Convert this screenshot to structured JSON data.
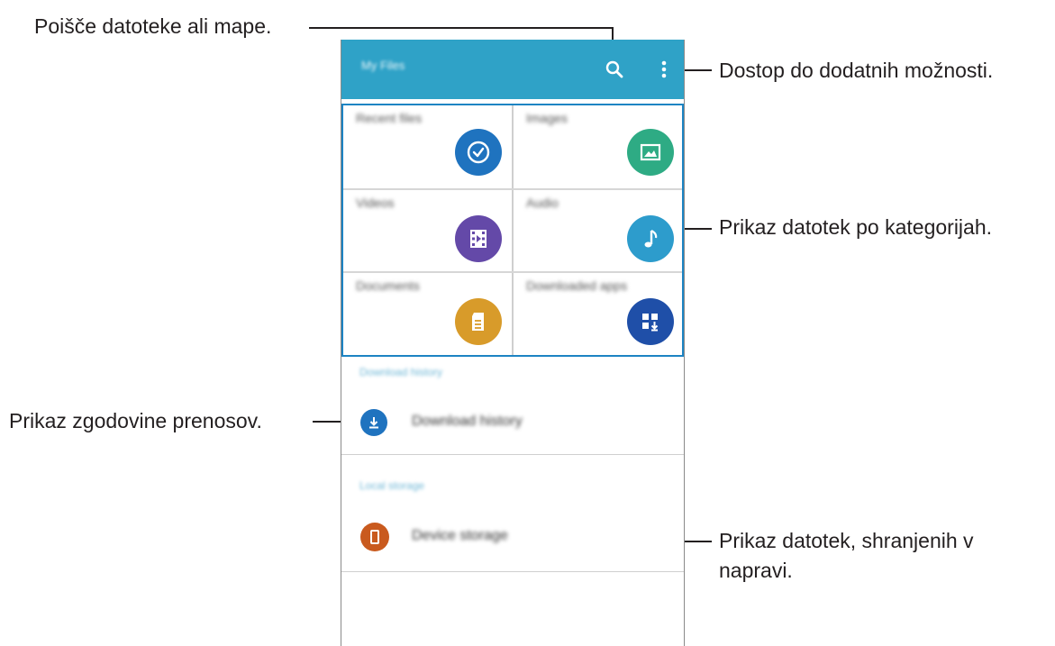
{
  "callouts": {
    "search": "Poišče datoteke ali mape.",
    "more_options": "Dostop do dodatnih možnosti.",
    "categories": "Prikaz datotek po kategorijah.",
    "download_history": "Prikaz zgodovine prenosov.",
    "device_storage_line1": "Prikaz datotek, shranjenih v",
    "device_storage_line2": "napravi."
  },
  "appbar": {
    "title": "My Files",
    "search_icon": "search-icon",
    "more_icon": "more-vertical-icon",
    "color": "#2fa2c7"
  },
  "categories": [
    {
      "label": "Recent files",
      "icon": "clock-icon",
      "color": "#1f73bf"
    },
    {
      "label": "Images",
      "icon": "image-icon",
      "color": "#2eab84"
    },
    {
      "label": "Videos",
      "icon": "film-icon",
      "color": "#6449a8"
    },
    {
      "label": "Audio",
      "icon": "music-note-icon",
      "color": "#2d9ccc"
    },
    {
      "label": "Documents",
      "icon": "document-icon",
      "color": "#d89b2a"
    },
    {
      "label": "Downloaded apps",
      "icon": "apps-download-icon",
      "color": "#1f4fa8"
    }
  ],
  "sections": {
    "download_history_header": "Download history",
    "download_history_item": "Download history",
    "local_storage_header": "Local storage",
    "device_storage_item": "Device storage"
  },
  "colors": {
    "highlight_border": "#1d84c3",
    "download_icon": "#1f73bf",
    "device_icon": "#c95a1e"
  }
}
